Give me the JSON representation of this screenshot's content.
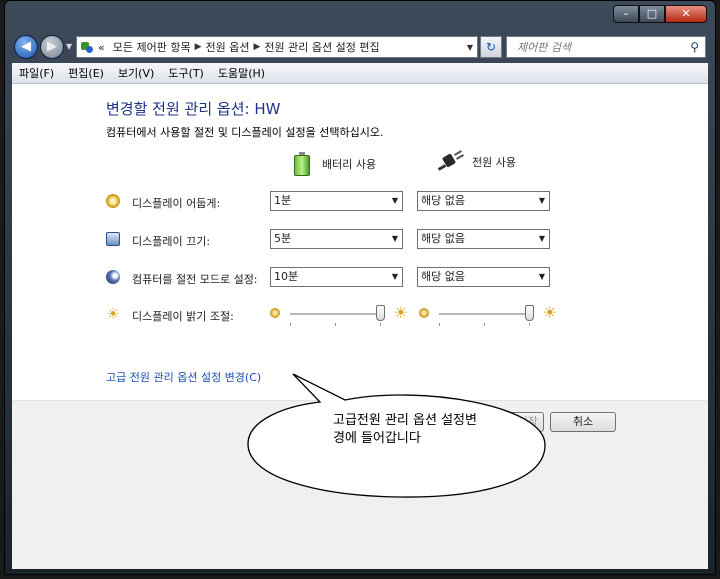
{
  "window": {
    "caption_minimize": "–",
    "caption_maximize": "□",
    "caption_close": "✕"
  },
  "nav": {
    "back_glyph": "◀",
    "forward_glyph": "▶",
    "breadcrumb_lead": "«",
    "breadcrumbs": [
      "모든 제어판 항목",
      "전원 옵션",
      "전원 관리 옵션 설정 편집"
    ],
    "refresh_glyph": "↻",
    "search_placeholder": "제어판 검색",
    "search_icon": "magnifier-icon"
  },
  "menu": [
    "파일(F)",
    "편집(E)",
    "보기(V)",
    "도구(T)",
    "도움말(H)"
  ],
  "page": {
    "heading": "변경할 전원 관리 옵션: HW",
    "subtitle": "컴퓨터에서 사용할 절전 및 디스플레이 설정을 선택하십시오.",
    "col_battery": "배터리 사용",
    "col_ac": "전원 사용"
  },
  "settings": [
    {
      "label": "디스플레이 어둡게:",
      "icon": "dim-display-icon",
      "battery": "1분",
      "ac": "해당 없음"
    },
    {
      "label": "디스플레이 끄기:",
      "icon": "display-off-icon",
      "battery": "5분",
      "ac": "해당 없음"
    },
    {
      "label": "컴퓨터를 절전 모드로 설정:",
      "icon": "sleep-icon",
      "battery": "10분",
      "ac": "해당 없음"
    }
  ],
  "brightness": {
    "label": "디스플레이 밝기 조절:",
    "battery_level": 1.0,
    "ac_level": 1.0
  },
  "advanced_link": "고급 전원 관리 옵션 설정 변경(C)",
  "buttons": {
    "save": "변경 내용 저장",
    "cancel": "취소"
  },
  "callout": {
    "text": "고급전원 관리 옵션 설정변경에 들어갑니다"
  }
}
